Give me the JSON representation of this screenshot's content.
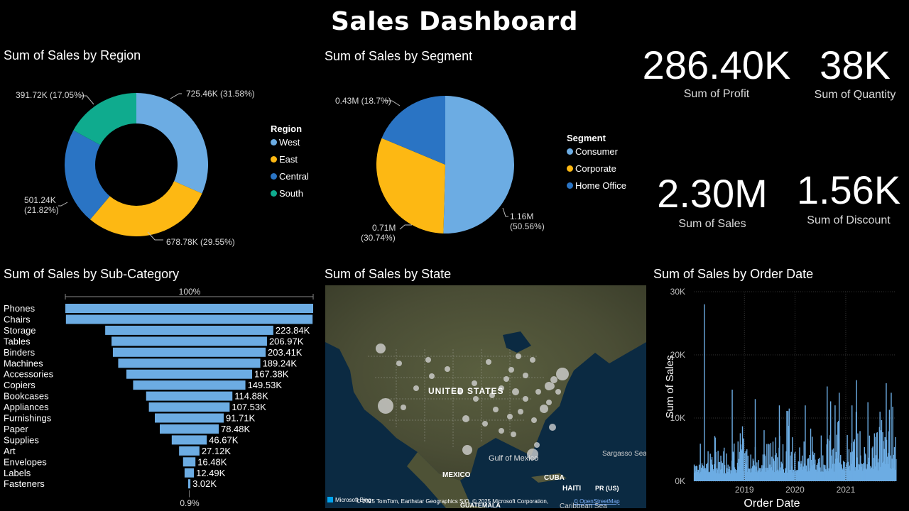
{
  "header": {
    "title": "Sales Dashboard"
  },
  "colors": {
    "west": "#6cace3",
    "east": "#fdb813",
    "central": "#2a74c4",
    "south": "#0fab8e",
    "bar": "#6cace3",
    "line": "#6cace3"
  },
  "kpis": [
    {
      "value": "286.40K",
      "label": "Sum of Profit"
    },
    {
      "value": "38K",
      "label": "Sum of Quantity"
    },
    {
      "value": "2.30M",
      "label": "Sum of Sales"
    },
    {
      "value": "1.56K",
      "label": "Sum of Discount"
    }
  ],
  "map": {
    "title": "Sum of Sales by State",
    "labels": {
      "country": "UNITED STATES",
      "mexico": "MEXICO",
      "gulf": "Gulf of Mexico",
      "cuba": "CUBA",
      "haiti": "HAITI",
      "pr": "PR (US)",
      "sargasso": "Sargasso Sea",
      "caribbean": "Caribbean Sea",
      "guatemala": "GUATEMALA"
    },
    "attribution": "© 2025 TomTom, Earthstar Geographics SIO, © 2025 Microsoft Corporation,",
    "attribution_link": "© OpenStreetMap",
    "logo": "Microsoft Bing"
  },
  "chart_data": [
    {
      "type": "pie",
      "variant": "donut",
      "title": "Sum of Sales by Region",
      "legend_title": "Region",
      "legend_position": "right",
      "categories": [
        "West",
        "East",
        "Central",
        "South"
      ],
      "values": [
        725.46,
        678.78,
        501.24,
        391.72
      ],
      "percents": [
        31.58,
        29.55,
        21.82,
        17.05
      ],
      "data_labels": [
        "725.46K (31.58%)",
        "678.78K (29.55%)",
        "501.24K",
        "(21.82%)",
        "391.72K (17.05%)"
      ],
      "unit": "K"
    },
    {
      "type": "pie",
      "title": "Sum of Sales by Segment",
      "legend_title": "Segment",
      "legend_position": "right",
      "categories": [
        "Consumer",
        "Corporate",
        "Home Office"
      ],
      "values": [
        1.16,
        0.71,
        0.43
      ],
      "percents": [
        50.56,
        30.74,
        18.7
      ],
      "data_labels": [
        "1.16M",
        "(50.56%)",
        "0.71M",
        "(30.74%)",
        "0.43M (18.7%)"
      ],
      "unit": "M"
    },
    {
      "type": "bar",
      "orientation": "horizontal",
      "variant": "funnel",
      "title": "Sum of Sales by Sub-Category",
      "top_label": "100%",
      "bottom_label": "0.9%",
      "categories": [
        "Phones",
        "Chairs",
        "Storage",
        "Tables",
        "Binders",
        "Machines",
        "Accessories",
        "Copiers",
        "Bookcases",
        "Appliances",
        "Furnishings",
        "Paper",
        "Supplies",
        "Art",
        "Envelopes",
        "Labels",
        "Fasteners"
      ],
      "values": [
        330.0,
        328.45,
        223.84,
        206.97,
        203.41,
        189.24,
        167.38,
        149.53,
        114.88,
        107.53,
        91.71,
        78.48,
        46.67,
        27.12,
        16.48,
        12.49,
        3.02
      ],
      "value_labels": [
        "",
        "",
        "223.84K",
        "206.97K",
        "203.41K",
        "189.24K",
        "167.38K",
        "149.53K",
        "114.88K",
        "107.53K",
        "91.71K",
        "78.48K",
        "46.67K",
        "27.12K",
        "16.48K",
        "12.49K",
        "3.02K"
      ],
      "unit": "K"
    },
    {
      "type": "line",
      "title": "Sum of Sales by Order Date",
      "xlabel": "Order Date",
      "ylabel": "Sum of Sales",
      "ylim": [
        0,
        30000
      ],
      "yticks": [
        "0K",
        "10K",
        "20K",
        "30K"
      ],
      "xticks": [
        "2019",
        "2020",
        "2021"
      ],
      "xlim": [
        "2018-01-01",
        "2021-12-31"
      ],
      "peaks": [
        {
          "date": "2018-03-18",
          "value": 28000
        },
        {
          "date": "2018-10-05",
          "value": 14500
        },
        {
          "date": "2019-03-20",
          "value": 13000
        },
        {
          "date": "2019-09-10",
          "value": 12000
        },
        {
          "date": "2019-11-20",
          "value": 11500
        },
        {
          "date": "2020-03-15",
          "value": 12000
        },
        {
          "date": "2020-08-20",
          "value": 15000
        },
        {
          "date": "2020-11-15",
          "value": 14000
        },
        {
          "date": "2021-02-15",
          "value": 12000
        },
        {
          "date": "2021-03-20",
          "value": 16000
        },
        {
          "date": "2021-06-10",
          "value": 12500
        },
        {
          "date": "2021-09-05",
          "value": 11000
        },
        {
          "date": "2021-10-20",
          "value": 15500
        },
        {
          "date": "2021-11-25",
          "value": 14000
        }
      ]
    }
  ]
}
